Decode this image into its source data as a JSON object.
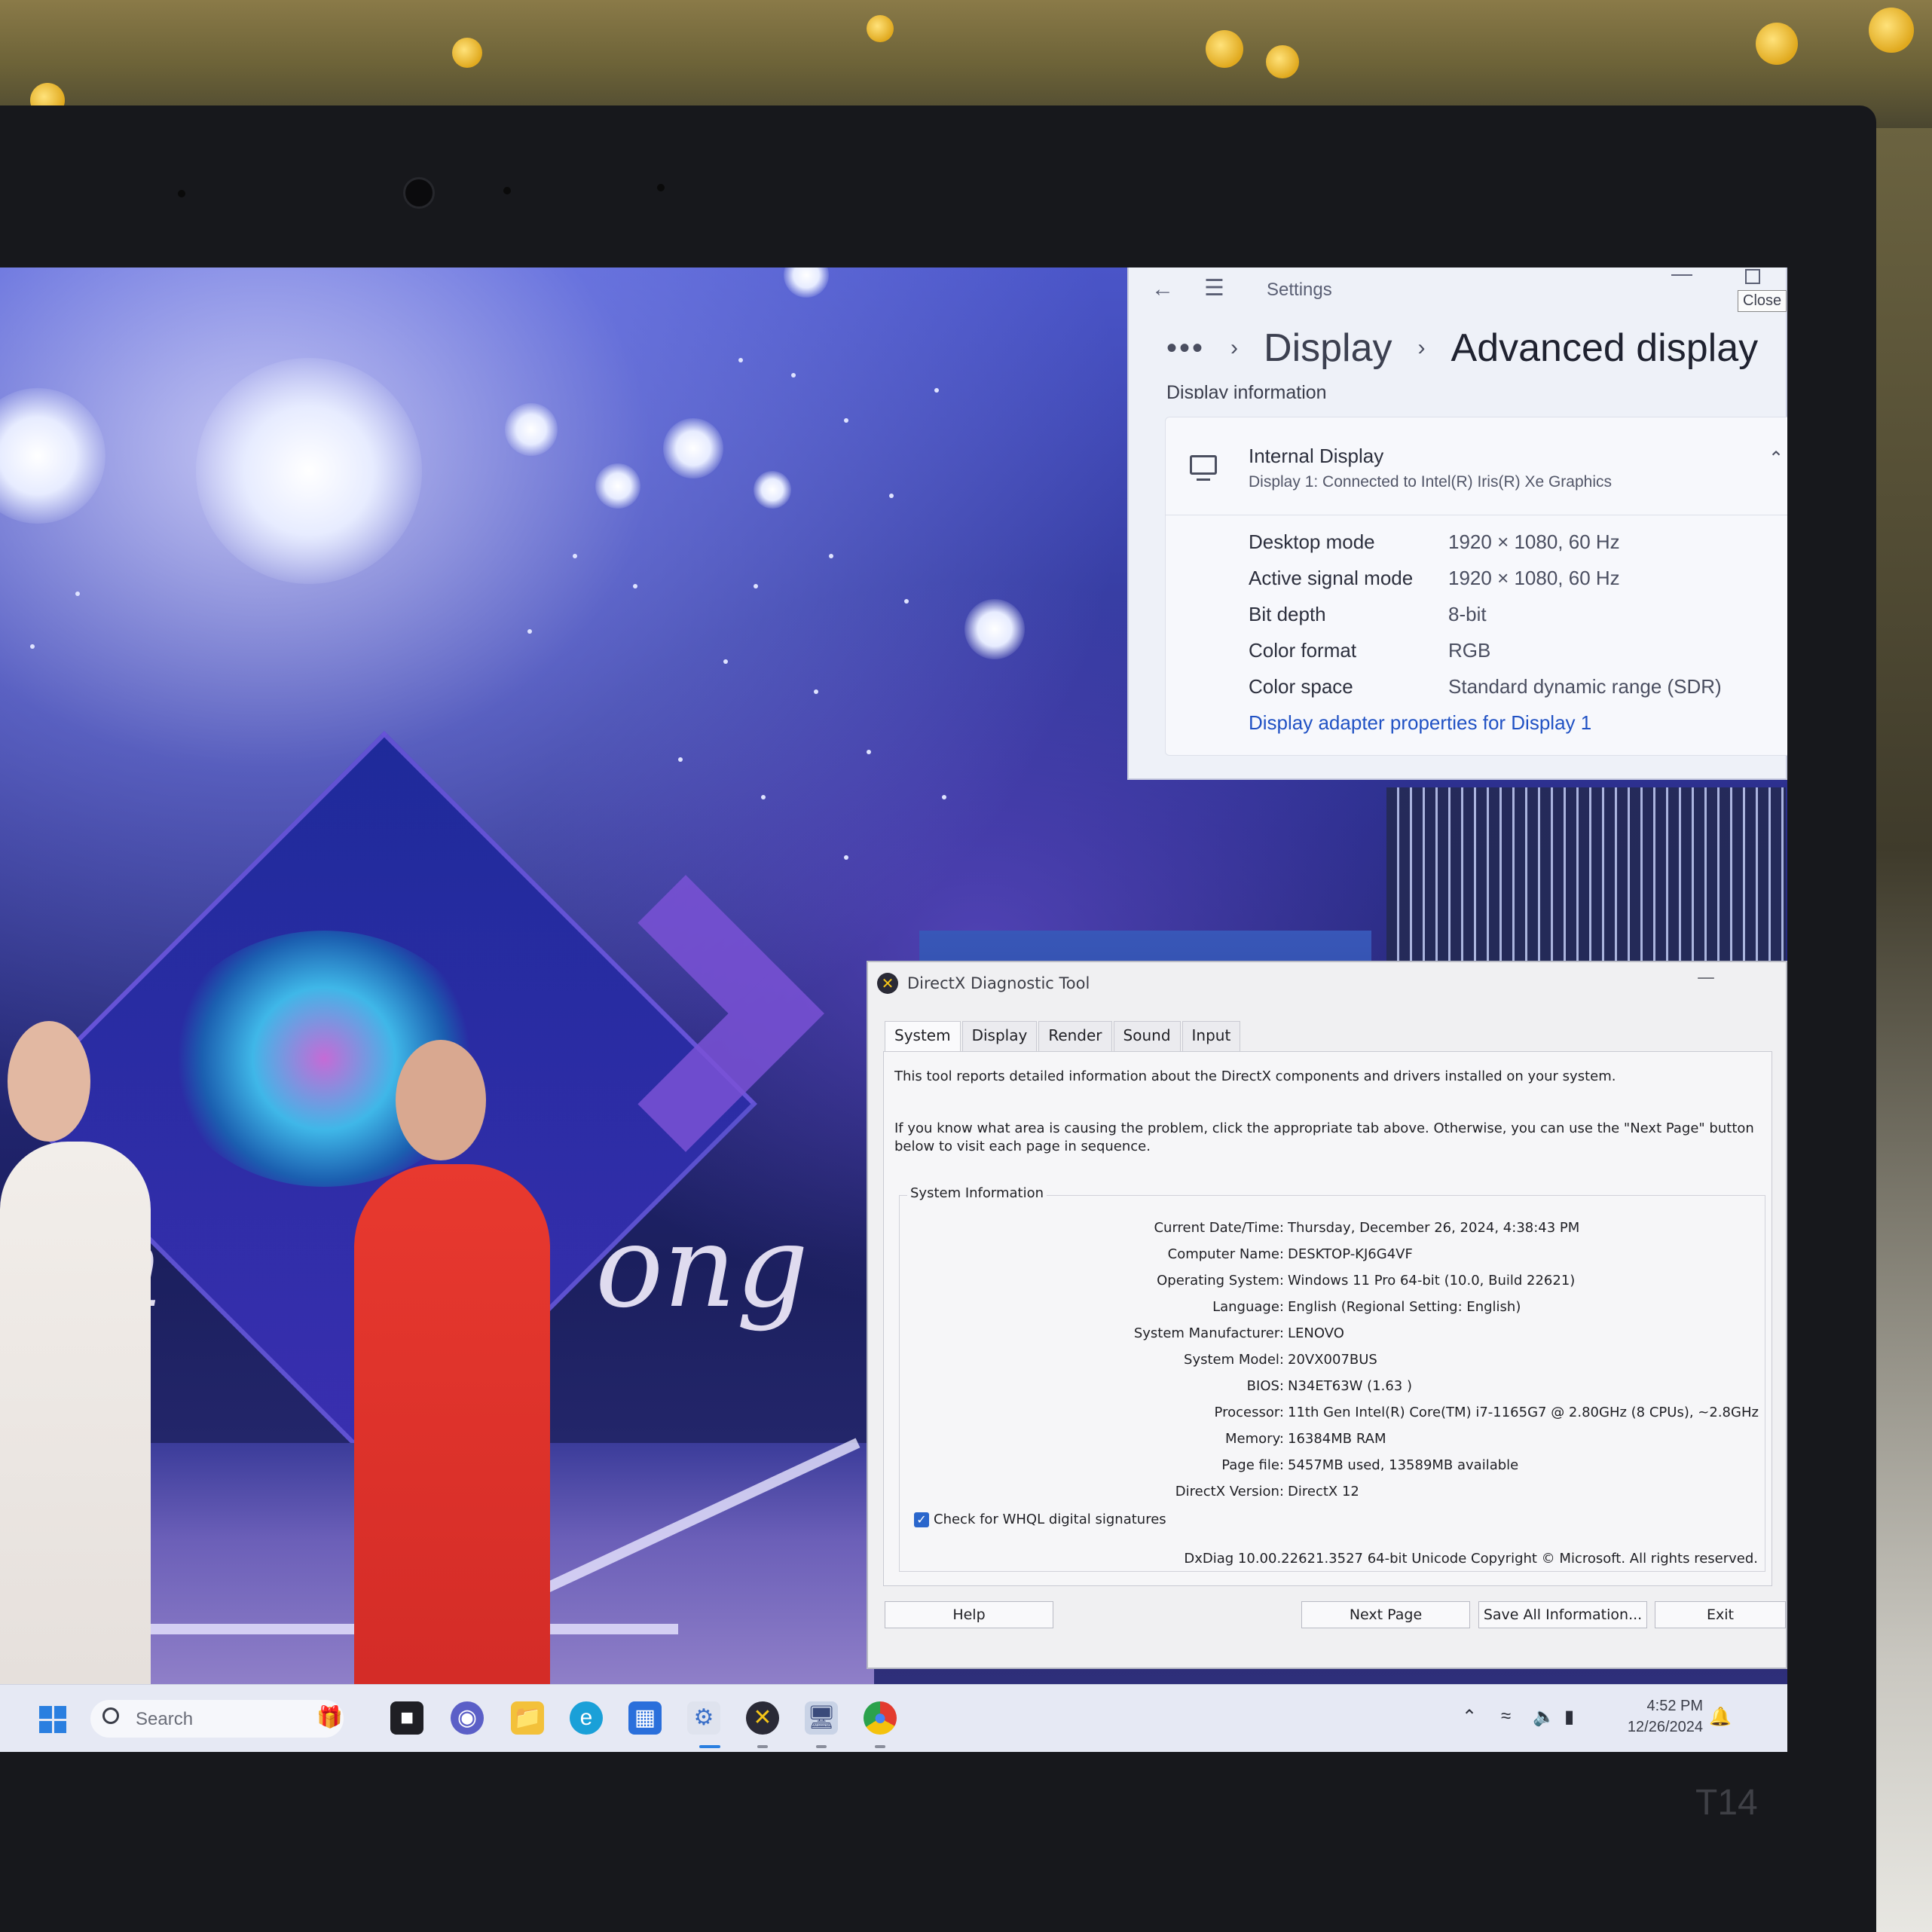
{
  "settings": {
    "window_title": "Settings",
    "close_tooltip": "Close",
    "breadcrumb": {
      "more": "•••",
      "parent": "Display",
      "current": "Advanced display"
    },
    "section_label": "Display information",
    "display": {
      "name": "Internal Display",
      "subtitle": "Display 1: Connected to Intel(R) Iris(R) Xe Graphics",
      "properties": [
        {
          "key": "Desktop mode",
          "value": "1920 × 1080, 60 Hz"
        },
        {
          "key": "Active signal mode",
          "value": "1920 × 1080, 60 Hz"
        },
        {
          "key": "Bit depth",
          "value": "8-bit"
        },
        {
          "key": "Color format",
          "value": "RGB"
        },
        {
          "key": "Color space",
          "value": "Standard dynamic range (SDR)"
        }
      ],
      "adapter_link": "Display adapter properties for Display 1"
    }
  },
  "dxdiag": {
    "window_title": "DirectX Diagnostic Tool",
    "tabs": [
      "System",
      "Display",
      "Render",
      "Sound",
      "Input"
    ],
    "active_tab": "System",
    "intro_line1": "This tool reports detailed information about the DirectX components and drivers installed on your system.",
    "intro_line2": "If you know what area is causing the problem, click the appropriate tab above.  Otherwise, you can use the \"Next Page\" button below to visit each page in sequence.",
    "group_label": "System Information",
    "info": [
      {
        "key": "Current Date/Time:",
        "value": "Thursday, December 26, 2024, 4:38:43 PM"
      },
      {
        "key": "Computer Name:",
        "value": "DESKTOP-KJ6G4VF"
      },
      {
        "key": "Operating System:",
        "value": "Windows 11 Pro 64-bit (10.0, Build 22621)"
      },
      {
        "key": "Language:",
        "value": "English (Regional Setting: English)"
      },
      {
        "key": "System Manufacturer:",
        "value": "LENOVO"
      },
      {
        "key": "System Model:",
        "value": "20VX007BUS"
      },
      {
        "key": "BIOS:",
        "value": "N34ET63W (1.63 )"
      },
      {
        "key": "Processor:",
        "value": "11th Gen Intel(R) Core(TM) i7-1165G7 @ 2.80GHz (8 CPUs), ~2.8GHz"
      },
      {
        "key": "Memory:",
        "value": "16384MB RAM"
      },
      {
        "key": "Page file:",
        "value": "5457MB used, 13589MB available"
      },
      {
        "key": "DirectX Version:",
        "value": "DirectX 12"
      }
    ],
    "whql_label": "Check for WHQL digital signatures",
    "whql_checked": true,
    "footer": "DxDiag 10.00.22621.3527 64-bit Unicode  Copyright © Microsoft. All rights reserved.",
    "buttons": {
      "help": "Help",
      "next": "Next Page",
      "save": "Save All Information...",
      "exit": "Exit"
    }
  },
  "taskbar": {
    "search_placeholder": "Search",
    "apps": [
      "file-explorer-black-icon",
      "teams-chat-icon",
      "file-explorer-icon",
      "edge-icon",
      "store-icon",
      "settings-icon",
      "dxdiag-icon",
      "system-config-icon",
      "chrome-icon"
    ],
    "time": "4:52 PM",
    "date": "12/26/2024"
  },
  "video": {
    "overlay_text_left": "n",
    "overlay_text_right": "ong"
  },
  "device": {
    "model_label": "T14"
  },
  "colors": {
    "accent": "#2152c4",
    "windows_blue": "#2a7fe0",
    "dx_checkbox": "#2a66cc",
    "singer_suit": "#d12a26"
  }
}
